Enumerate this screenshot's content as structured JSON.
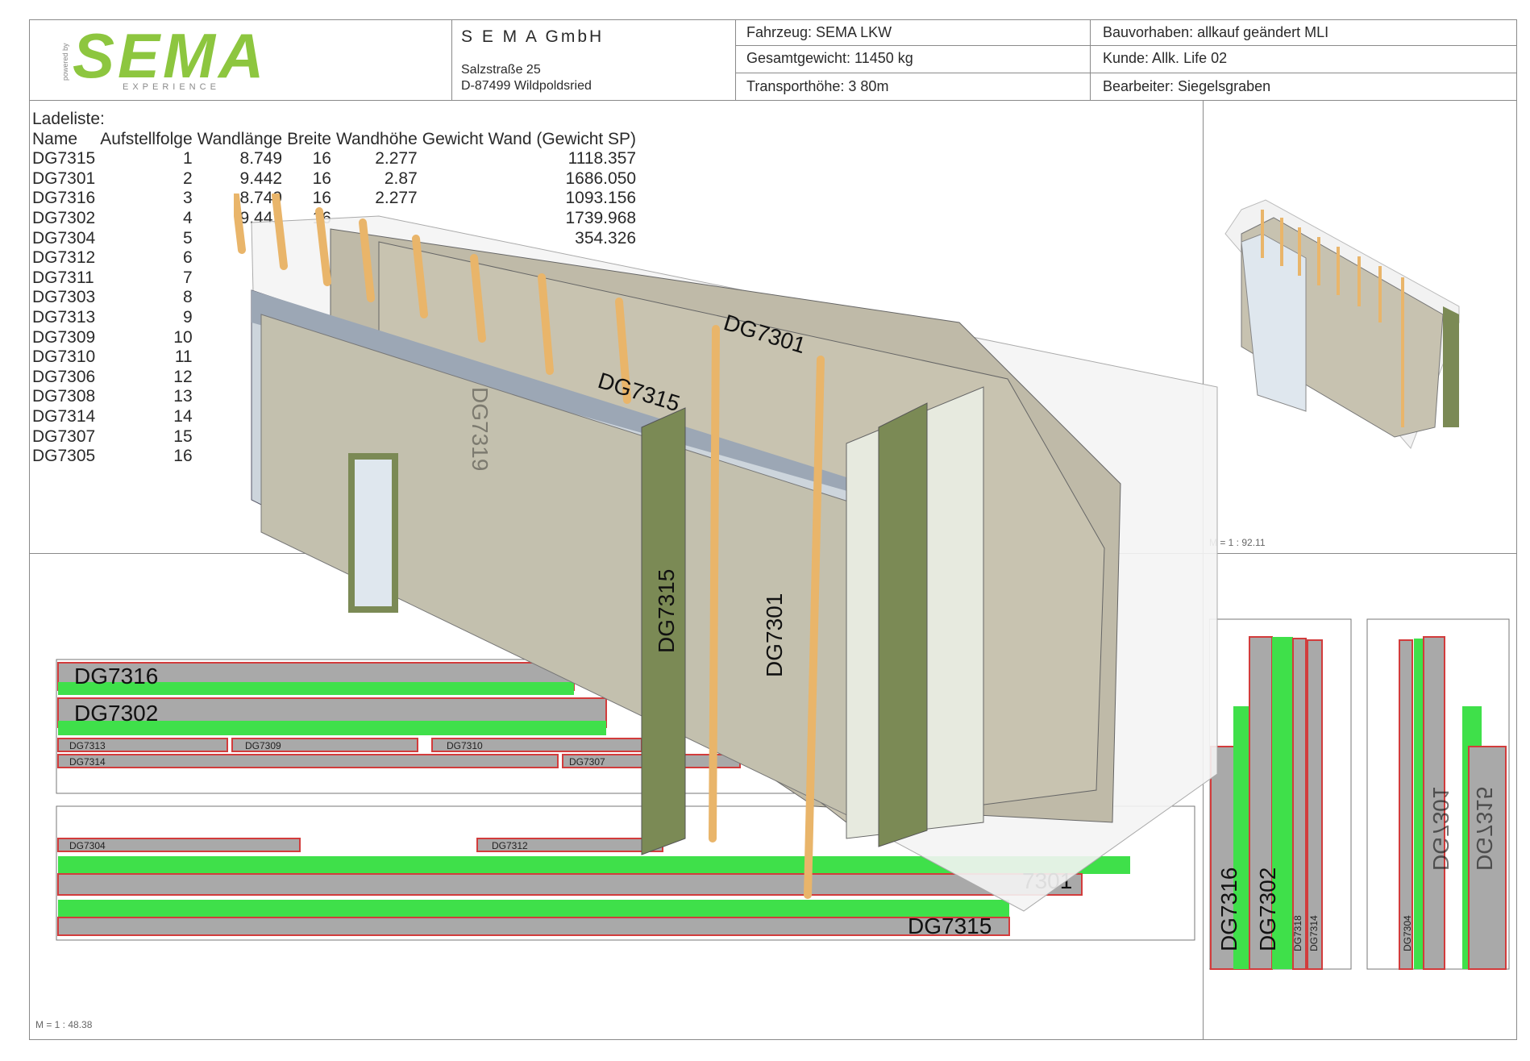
{
  "header": {
    "logo_text": "SEMA",
    "logo_sub": "EXPERIENCE",
    "logo_powered": "powered by",
    "company": "S E M A GmbH",
    "street": "Salzstraße 25",
    "city": "D-87499 Wildpoldsried",
    "vehicle": "Fahrzeug: SEMA LKW",
    "total_weight": "Gesamtgewicht: 11450 kg",
    "transport_height": "Transporthöhe: 3 80m",
    "project": "Bauvorhaben: allkauf geändert MLI",
    "customer": "Kunde: Allk. Life 02",
    "editor": "Bearbeiter: Siegelsgraben"
  },
  "loadlist": {
    "title": "Ladeliste:",
    "columns": [
      "Name",
      "Aufstellfolge",
      "Wandlänge",
      "Breite",
      "Wandhöhe",
      "Gewicht Wand (Gewicht SP)"
    ],
    "rows": [
      {
        "name": "DG7315",
        "order": "1",
        "length": "8.749",
        "width": "16",
        "height": "2.277",
        "weight": "1118.357"
      },
      {
        "name": "DG7301",
        "order": "2",
        "length": "9.442",
        "width": "16",
        "height": "2.87",
        "weight": "1686.050"
      },
      {
        "name": "DG7316",
        "order": "3",
        "length": "8.749",
        "width": "16",
        "height": "2.277",
        "weight": "1093.156"
      },
      {
        "name": "DG7302",
        "order": "4",
        "length": "9.442",
        "width": "16",
        "height": "",
        "weight": "1739.968"
      },
      {
        "name": "DG7304",
        "order": "5",
        "length": "",
        "width": "",
        "height": "",
        "weight": "354.326"
      },
      {
        "name": "DG7312",
        "order": "6",
        "length": "",
        "width": "",
        "height": "",
        "weight": ""
      },
      {
        "name": "DG7311",
        "order": "7",
        "length": "",
        "width": "",
        "height": "",
        "weight": ""
      },
      {
        "name": "DG7303",
        "order": "8",
        "length": "",
        "width": "",
        "height": "",
        "weight": ""
      },
      {
        "name": "DG7313",
        "order": "9",
        "length": "",
        "width": "",
        "height": "",
        "weight": ""
      },
      {
        "name": "DG7309",
        "order": "10",
        "length": "",
        "width": "",
        "height": "",
        "weight": ""
      },
      {
        "name": "DG7310",
        "order": "11",
        "length": "",
        "width": "",
        "height": "",
        "weight": ""
      },
      {
        "name": "DG7306",
        "order": "12",
        "length": "",
        "width": "",
        "height": "",
        "weight": ""
      },
      {
        "name": "DG7308",
        "order": "13",
        "length": "",
        "width": "",
        "height": "",
        "weight": ""
      },
      {
        "name": "DG7314",
        "order": "14",
        "length": "",
        "width": "",
        "height": "",
        "weight": ""
      },
      {
        "name": "DG7307",
        "order": "15",
        "length": "",
        "width": "",
        "height": "",
        "weight": ""
      },
      {
        "name": "DG7305",
        "order": "16",
        "length": "",
        "width": "",
        "height": "",
        "weight": ""
      }
    ]
  },
  "scales": {
    "overview": "M = 1 : 92.11",
    "plan": "M = 1 : 48.38"
  },
  "labels": {
    "dg7316": "DG7316",
    "dg7302": "DG7302",
    "dg7313": "DG7313",
    "dg7309": "DG7309",
    "dg7310": "DG7310",
    "dg7314": "DG7314",
    "dg7307": "DG7307",
    "dg7304": "DG7304",
    "dg7312": "DG7312",
    "dg7301": "DG7301",
    "dg7301_partial": "7301",
    "dg7315": "DG7315",
    "dg7319": "DG7319",
    "dg7318": "DG7318",
    "dg7314_side": "DG7314",
    "dg7304_side": "DG7304",
    "dg7301_mirror": "DG7301",
    "dg7315_mirror": "DG7315"
  },
  "colors": {
    "brand_green": "#8dc63f",
    "panel_green": "#3fe04a",
    "panel_gray": "#a9a9a9",
    "panel_red": "#d23c3c",
    "timber": "#e9b56a"
  }
}
